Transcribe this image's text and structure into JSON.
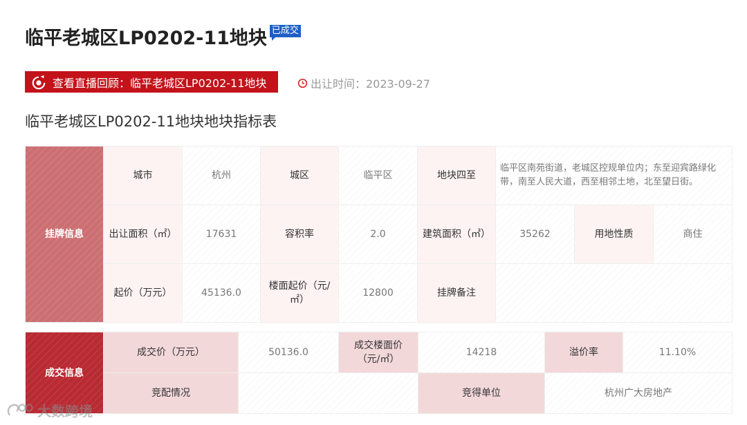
{
  "header": {
    "title": "临平老城区LP0202-11地块",
    "status_badge": "已成交"
  },
  "live_replay": {
    "label": "查看直播回顾：临平老城区LP0202-11地块"
  },
  "transfer_time": {
    "label": "出让时间：2023-09-27"
  },
  "table_title": "临平老城区LP0202-11地块地块指标表",
  "listing": {
    "section_label": "挂牌信息",
    "city_label": "城市",
    "city": "杭州",
    "district_label": "城区",
    "district": "临平区",
    "boundary_label": "地块四至",
    "boundary": "临平区南苑街道，老城区控规单位内；东至迎宾路绿化带，南至人民大道，西至相邻土地，北至望日街。",
    "area_label": "出让面积（㎡）",
    "area": "17631",
    "far_label": "容积率",
    "far": "2.0",
    "building_area_label": "建筑面积（㎡）",
    "building_area": "35262",
    "land_use_label": "用地性质",
    "land_use": "商住",
    "start_price_label": "起价（万元）",
    "start_price": "45136.0",
    "floor_start_price_label": "楼面起价（元/㎡）",
    "floor_start_price": "12800",
    "remark_label": "挂牌备注",
    "remark": ""
  },
  "deal": {
    "section_label": "成交信息",
    "price_label": "成交价（万元）",
    "price": "50136.0",
    "floor_price_label": "成交楼面价（元/㎡）",
    "floor_price": "14218",
    "premium_label": "溢价率",
    "premium": "11.10%",
    "bidding_label": "竞配情况",
    "bidding": "",
    "winner_label": "竞得单位",
    "winner": "杭州广大房地产"
  },
  "watermark": {
    "label": "大数跨境"
  },
  "colors": {
    "accent_red": "#c3121a",
    "badge_blue": "#1f5fc5",
    "listing_header": "#cc6f73",
    "deal_header": "#b92a33"
  }
}
